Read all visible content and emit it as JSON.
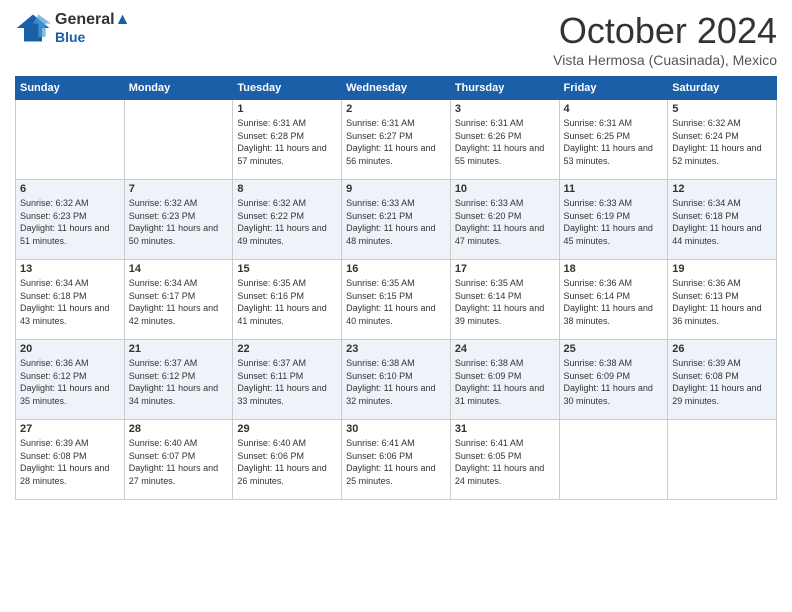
{
  "header": {
    "logo_line1": "General",
    "logo_line2": "Blue",
    "month_title": "October 2024",
    "subtitle": "Vista Hermosa (Cuasinada), Mexico"
  },
  "days_of_week": [
    "Sunday",
    "Monday",
    "Tuesday",
    "Wednesday",
    "Thursday",
    "Friday",
    "Saturday"
  ],
  "weeks": [
    [
      {
        "day": "",
        "info": ""
      },
      {
        "day": "",
        "info": ""
      },
      {
        "day": "1",
        "sunrise": "6:31 AM",
        "sunset": "6:28 PM",
        "daylight": "11 hours and 57 minutes."
      },
      {
        "day": "2",
        "sunrise": "6:31 AM",
        "sunset": "6:27 PM",
        "daylight": "11 hours and 56 minutes."
      },
      {
        "day": "3",
        "sunrise": "6:31 AM",
        "sunset": "6:26 PM",
        "daylight": "11 hours and 55 minutes."
      },
      {
        "day": "4",
        "sunrise": "6:31 AM",
        "sunset": "6:25 PM",
        "daylight": "11 hours and 53 minutes."
      },
      {
        "day": "5",
        "sunrise": "6:32 AM",
        "sunset": "6:24 PM",
        "daylight": "11 hours and 52 minutes."
      }
    ],
    [
      {
        "day": "6",
        "sunrise": "6:32 AM",
        "sunset": "6:23 PM",
        "daylight": "11 hours and 51 minutes."
      },
      {
        "day": "7",
        "sunrise": "6:32 AM",
        "sunset": "6:23 PM",
        "daylight": "11 hours and 50 minutes."
      },
      {
        "day": "8",
        "sunrise": "6:32 AM",
        "sunset": "6:22 PM",
        "daylight": "11 hours and 49 minutes."
      },
      {
        "day": "9",
        "sunrise": "6:33 AM",
        "sunset": "6:21 PM",
        "daylight": "11 hours and 48 minutes."
      },
      {
        "day": "10",
        "sunrise": "6:33 AM",
        "sunset": "6:20 PM",
        "daylight": "11 hours and 47 minutes."
      },
      {
        "day": "11",
        "sunrise": "6:33 AM",
        "sunset": "6:19 PM",
        "daylight": "11 hours and 45 minutes."
      },
      {
        "day": "12",
        "sunrise": "6:34 AM",
        "sunset": "6:18 PM",
        "daylight": "11 hours and 44 minutes."
      }
    ],
    [
      {
        "day": "13",
        "sunrise": "6:34 AM",
        "sunset": "6:18 PM",
        "daylight": "11 hours and 43 minutes."
      },
      {
        "day": "14",
        "sunrise": "6:34 AM",
        "sunset": "6:17 PM",
        "daylight": "11 hours and 42 minutes."
      },
      {
        "day": "15",
        "sunrise": "6:35 AM",
        "sunset": "6:16 PM",
        "daylight": "11 hours and 41 minutes."
      },
      {
        "day": "16",
        "sunrise": "6:35 AM",
        "sunset": "6:15 PM",
        "daylight": "11 hours and 40 minutes."
      },
      {
        "day": "17",
        "sunrise": "6:35 AM",
        "sunset": "6:14 PM",
        "daylight": "11 hours and 39 minutes."
      },
      {
        "day": "18",
        "sunrise": "6:36 AM",
        "sunset": "6:14 PM",
        "daylight": "11 hours and 38 minutes."
      },
      {
        "day": "19",
        "sunrise": "6:36 AM",
        "sunset": "6:13 PM",
        "daylight": "11 hours and 36 minutes."
      }
    ],
    [
      {
        "day": "20",
        "sunrise": "6:36 AM",
        "sunset": "6:12 PM",
        "daylight": "11 hours and 35 minutes."
      },
      {
        "day": "21",
        "sunrise": "6:37 AM",
        "sunset": "6:12 PM",
        "daylight": "11 hours and 34 minutes."
      },
      {
        "day": "22",
        "sunrise": "6:37 AM",
        "sunset": "6:11 PM",
        "daylight": "11 hours and 33 minutes."
      },
      {
        "day": "23",
        "sunrise": "6:38 AM",
        "sunset": "6:10 PM",
        "daylight": "11 hours and 32 minutes."
      },
      {
        "day": "24",
        "sunrise": "6:38 AM",
        "sunset": "6:09 PM",
        "daylight": "11 hours and 31 minutes."
      },
      {
        "day": "25",
        "sunrise": "6:38 AM",
        "sunset": "6:09 PM",
        "daylight": "11 hours and 30 minutes."
      },
      {
        "day": "26",
        "sunrise": "6:39 AM",
        "sunset": "6:08 PM",
        "daylight": "11 hours and 29 minutes."
      }
    ],
    [
      {
        "day": "27",
        "sunrise": "6:39 AM",
        "sunset": "6:08 PM",
        "daylight": "11 hours and 28 minutes."
      },
      {
        "day": "28",
        "sunrise": "6:40 AM",
        "sunset": "6:07 PM",
        "daylight": "11 hours and 27 minutes."
      },
      {
        "day": "29",
        "sunrise": "6:40 AM",
        "sunset": "6:06 PM",
        "daylight": "11 hours and 26 minutes."
      },
      {
        "day": "30",
        "sunrise": "6:41 AM",
        "sunset": "6:06 PM",
        "daylight": "11 hours and 25 minutes."
      },
      {
        "day": "31",
        "sunrise": "6:41 AM",
        "sunset": "6:05 PM",
        "daylight": "11 hours and 24 minutes."
      },
      {
        "day": "",
        "info": ""
      },
      {
        "day": "",
        "info": ""
      }
    ]
  ],
  "labels": {
    "sunrise": "Sunrise: ",
    "sunset": "Sunset: ",
    "daylight": "Daylight: "
  }
}
